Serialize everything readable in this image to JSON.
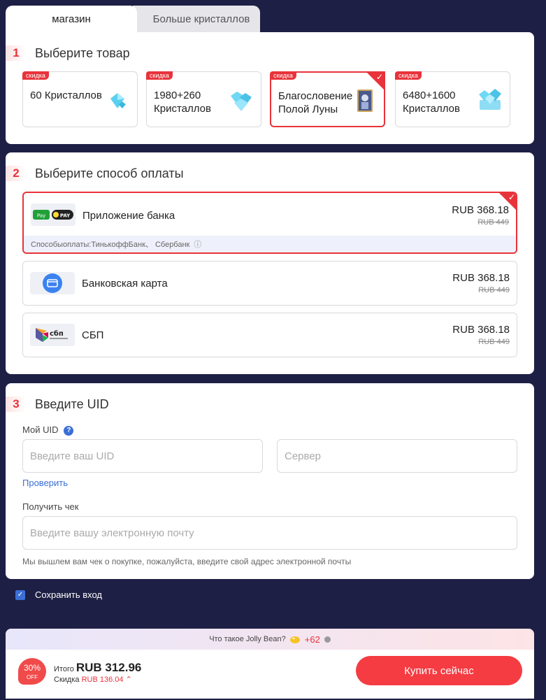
{
  "tabs": {
    "store": "магазин",
    "more": "Больше кристаллов"
  },
  "section1": {
    "num": "1",
    "title": "Выберите товар",
    "badge": "скидка",
    "products": [
      {
        "name": "60 Кристаллов",
        "selected": false
      },
      {
        "name": "1980+260 Кристаллов",
        "selected": false
      },
      {
        "name": "Благословение Полой Луны",
        "selected": true
      },
      {
        "name": "6480+1600 Кристаллов",
        "selected": false
      }
    ]
  },
  "section2": {
    "num": "2",
    "title": "Выберите способ оплаты",
    "methods": [
      {
        "name": "Приложение банка",
        "price": "RUB 368.18",
        "old": "RUB 449",
        "note": "Способыоплаты:ТинькоффБанк、 Сбербанк",
        "selected": true
      },
      {
        "name": "Банковская карта",
        "price": "RUB 368.18",
        "old": "RUB 449",
        "selected": false
      },
      {
        "name": "СБП",
        "price": "RUB 368.18",
        "old": "RUB 449",
        "selected": false
      }
    ]
  },
  "section3": {
    "num": "3",
    "title": "Введите UID",
    "uid_label": "Мой UID",
    "uid_placeholder": "Введите ваш UID",
    "server_placeholder": "Сервер",
    "check_link": "Проверить",
    "receipt_label": "Получить чек",
    "email_placeholder": "Введите вашу электронную почту",
    "note": "Мы вышлем вам чек о покупке, пожалуйста, введите свой адрес электронной почты"
  },
  "remember": "Сохранить вход",
  "bottom": {
    "jolly": "Что такое Jolly Bean?",
    "jolly_plus": "+62",
    "off_pct": "30%",
    "off_label": "OFF",
    "total_label": "Итого",
    "total": "RUB 312.96",
    "discount_label": "Скидка",
    "discount": "RUB 136.04",
    "buy": "Купить сейчас"
  },
  "colors": {
    "accent": "#e8333b",
    "link": "#3b6fd6",
    "background": "#1e1f44"
  }
}
